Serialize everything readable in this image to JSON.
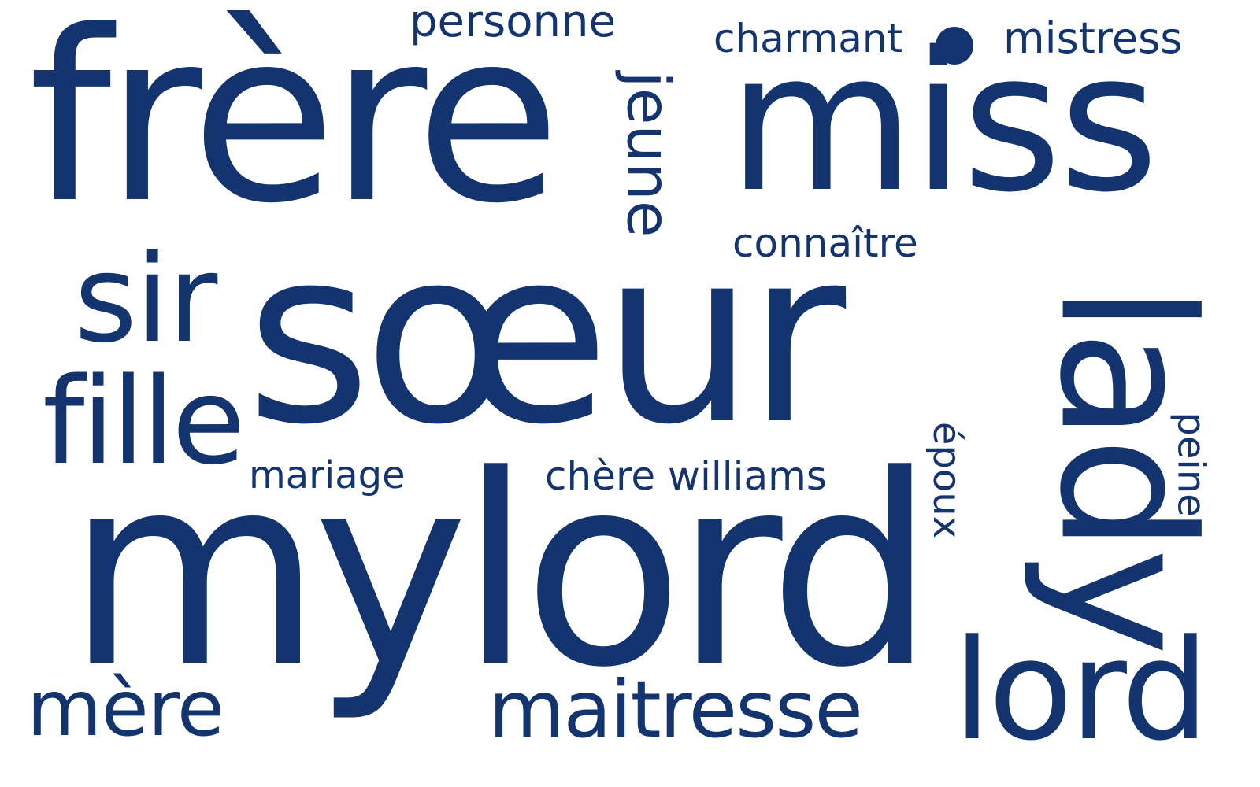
{
  "words": {
    "frere": "frère",
    "soeur": "sœur",
    "mylord": "mylord",
    "miss": "miss",
    "lady": "lady",
    "lord": "lord",
    "sir": "sir",
    "fille": "fille",
    "mere": "mère",
    "maitresse": "maitresse",
    "personne": "personne",
    "charmant": "charmant",
    "mistress": "mistress",
    "jeune": "jeune",
    "connaitre": "connaître",
    "mariage": "mariage",
    "chere_williams": "chère williams",
    "epoux": "époux",
    "peine": "peine"
  },
  "colors": {
    "text": "#13346f",
    "background": "#ffffff"
  }
}
